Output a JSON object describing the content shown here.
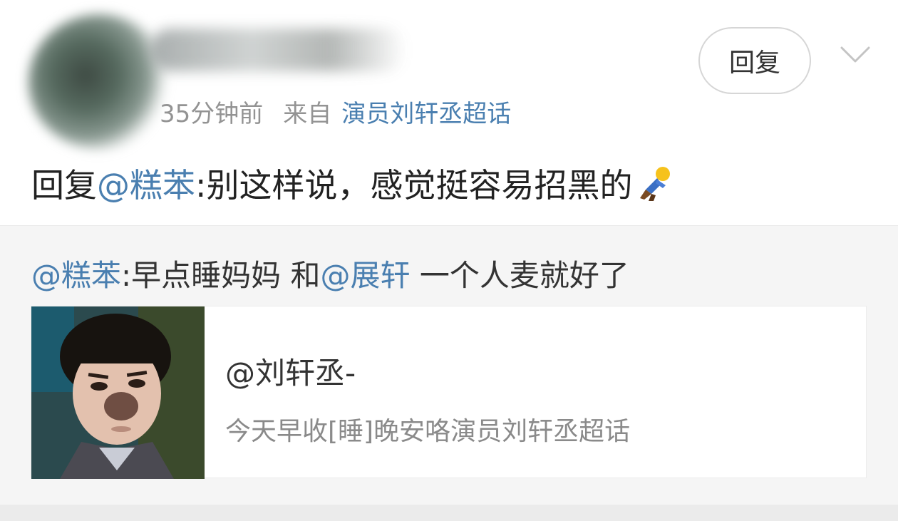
{
  "header": {
    "time": "35分钟前",
    "source_prefix": "来自",
    "source_topic": "演员刘轩丞超话",
    "reply_label": "回复"
  },
  "comment": {
    "prefix": "回复",
    "mention": "@糕苯",
    "body": ":别这样说，感觉挺容易招黑的"
  },
  "quote": {
    "mention1": "@糕苯",
    "text1": ":早点睡妈妈 和",
    "mention2": "@展轩",
    "text2": " 一个人麦就好了"
  },
  "card": {
    "title": "@刘轩丞-",
    "subtitle": "今天早收[睡]晚安咯演员刘轩丞超话"
  },
  "colors": {
    "link": "#4a7fb0",
    "meta": "#939393",
    "quote_bg": "#f5f5f5"
  }
}
